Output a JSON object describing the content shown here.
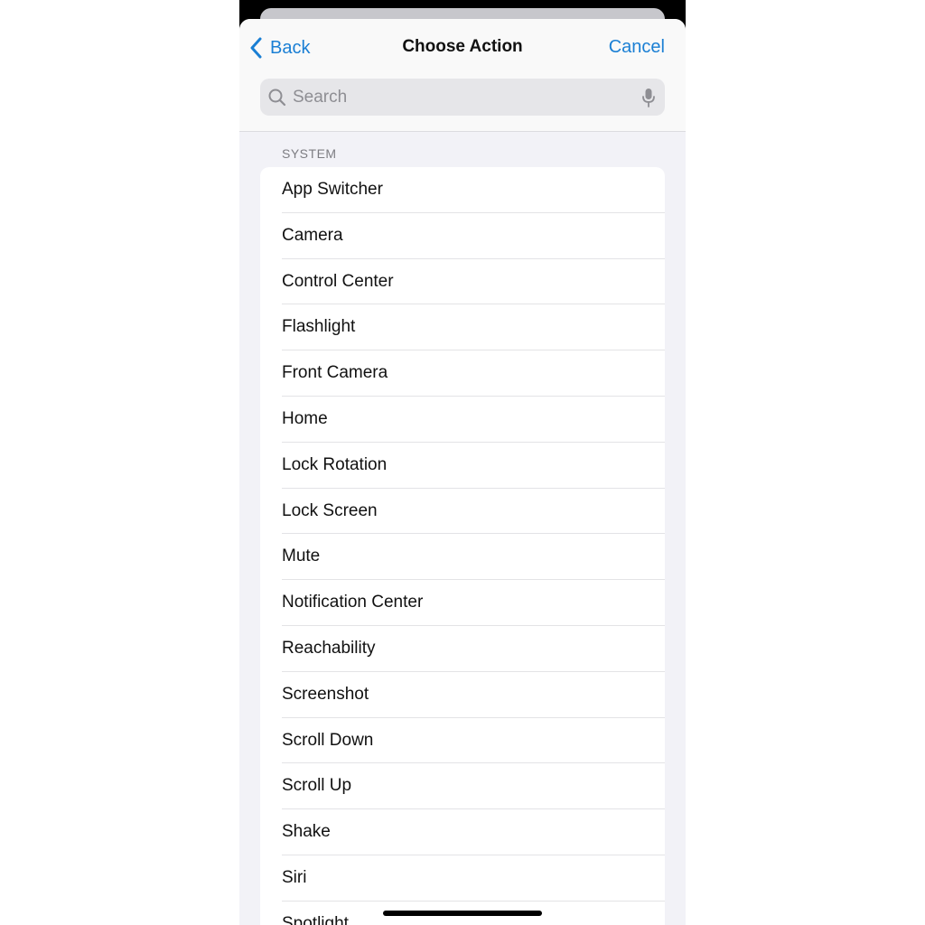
{
  "nav": {
    "back_label": "Back",
    "title": "Choose Action",
    "cancel_label": "Cancel"
  },
  "search": {
    "placeholder": "Search"
  },
  "section": {
    "header": "SYSTEM",
    "items": [
      {
        "label": "App Switcher"
      },
      {
        "label": "Camera"
      },
      {
        "label": "Control Center"
      },
      {
        "label": "Flashlight"
      },
      {
        "label": "Front Camera"
      },
      {
        "label": "Home"
      },
      {
        "label": "Lock Rotation"
      },
      {
        "label": "Lock Screen"
      },
      {
        "label": "Mute"
      },
      {
        "label": "Notification Center"
      },
      {
        "label": "Reachability"
      },
      {
        "label": "Screenshot"
      },
      {
        "label": "Scroll Down"
      },
      {
        "label": "Scroll Up"
      },
      {
        "label": "Shake"
      },
      {
        "label": "Siri"
      },
      {
        "label": "Spotlight"
      }
    ]
  },
  "colors": {
    "accent": "#1a7fd4",
    "background": "#f2f2f7",
    "separator": "#e3e3e6"
  },
  "icons": {
    "back": "chevron-left-icon",
    "search": "magnifying-glass-icon",
    "mic": "microphone-icon"
  }
}
